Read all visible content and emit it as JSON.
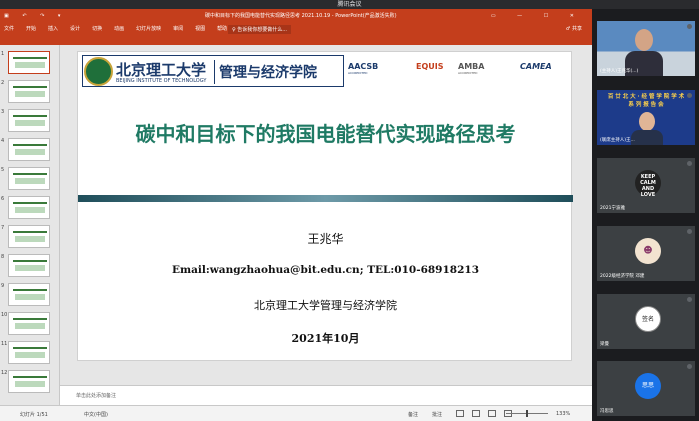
{
  "meeting": {
    "title": "腾讯会议"
  },
  "powerpoint": {
    "quick_access": "▣ ↶ ↷ ▾",
    "window_title": "碳中和目标下的我国电能替代实现路径思考 2021.10.19 - PowerPoint(产品激活失败)",
    "window_controls": "▭ — ☐ ✕",
    "tabs": [
      "文件",
      "开始",
      "插入",
      "设计",
      "切换",
      "动画",
      "幻灯片放映",
      "审阅",
      "视图",
      "帮助"
    ],
    "tell_me": "♀ 告诉我你想要做什么...",
    "share": "♂ 共享"
  },
  "thumbnails": {
    "numbers": [
      "1",
      "2",
      "3",
      "4",
      "5",
      "6",
      "7",
      "8",
      "9",
      "10",
      "11",
      "12"
    ]
  },
  "slide": {
    "university_cn": "北京理工大学",
    "university_en": "BEIJING INSTITUTE OF TECHNOLOGY",
    "school": "管理与经济学院",
    "accreditations": {
      "aacsb": "AACSB",
      "aacsb_sub": "ACCREDITED",
      "equis": "EQUIS",
      "amba": "AMBA",
      "amba_sub": "ACCREDITED",
      "camea": "CAMEA"
    },
    "title": "碳中和目标下的我国电能替代实现路径思考",
    "author": "王兆华",
    "contact": "Email:wangzhaohua@bit.edu.cn;   TEL:010-68918213",
    "institution": "北京理工大学管理与经济学院",
    "date": "2021年10月"
  },
  "notes_placeholder": "单击此处添加备注",
  "status": {
    "slide": "幻灯片 1/51",
    "language": "中文(中国)",
    "notes": "备注",
    "comments": "批注",
    "zoom": "133%"
  },
  "participants": [
    {
      "name": "(主持人)王兆华(...)"
    },
    {
      "name": "(联席主持人)王...",
      "banner": "百 廿 北 大 · 经 管 学 院 学 术 系 列 报 告 会"
    },
    {
      "name": "2021宁波雅",
      "avatar": "KEEP CALM AND LOVE"
    },
    {
      "name": "2022级经济学院 邓建",
      "avatar": "☻"
    },
    {
      "name": "梁曼",
      "avatar": "签名"
    },
    {
      "name": "冯思思",
      "avatar": "思思"
    }
  ],
  "colors": {
    "ppt_red": "#c43e1c",
    "title_green": "#1f7a64",
    "band": "#1f4e5a",
    "navy": "#1b3a6b"
  }
}
